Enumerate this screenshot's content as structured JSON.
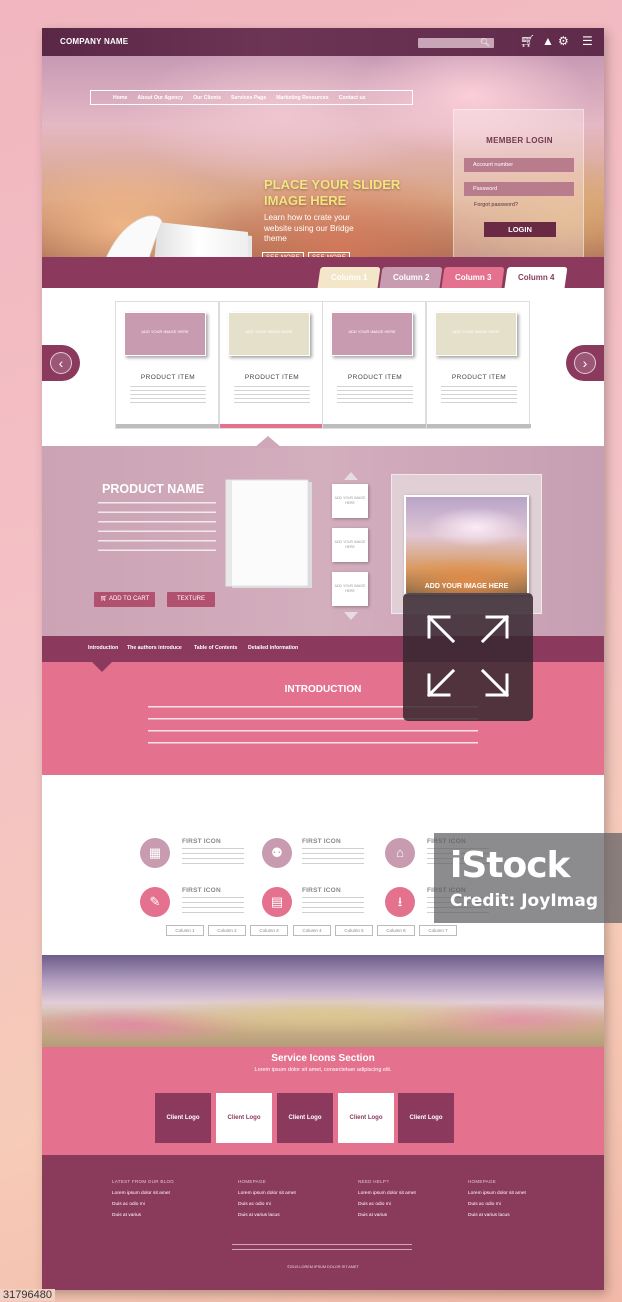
{
  "header": {
    "company_name": "COMPANY NAME",
    "icons": [
      "search-icon",
      "cart-icon",
      "user-icon",
      "gear-icon",
      "menu-icon"
    ]
  },
  "nav": {
    "items": [
      "Home",
      "About Our Agency",
      "Our Clients",
      "Services Page",
      "Marketing Resources",
      "Contact us"
    ]
  },
  "hero": {
    "slider_title": "PLACE YOUR SLIDER IMAGE HERE",
    "slider_subtitle": "Learn how to crate your website using our Bridge theme",
    "see_more_1": "SEE MORE",
    "see_more_2": "SEE MORE"
  },
  "login": {
    "title": "MEMBER LOGIN",
    "account_placeholder": "Account number",
    "password_placeholder": "Password",
    "forgot": "Forgot password?",
    "button": "LOGIN"
  },
  "column_tabs": [
    "Column 1",
    "Column 2",
    "Column 3",
    "Column 4"
  ],
  "products": [
    {
      "image_text": "ADD YOUR IMAGE HERE",
      "title": "PRODUCT ITEM"
    },
    {
      "image_text": "ADD YOUR IMAGE HERE",
      "title": "PRODUCT ITEM"
    },
    {
      "image_text": "ADD YOUR IMAGE HERE",
      "title": "PRODUCT ITEM"
    },
    {
      "image_text": "ADD YOUR IMAGE HERE",
      "title": "PRODUCT ITEM"
    }
  ],
  "product_detail": {
    "name": "PRODUCT NAME",
    "add_to_cart": "ADD TO CART",
    "texture": "TEXTURE",
    "thumb_text": "ADD YOUR IMAGE HERE",
    "popup_caption": "ADD YOUR IMAGE HERE"
  },
  "intro_tabs": [
    "Introduction",
    "The authors introduce",
    "Table of Contents",
    "Detailed information"
  ],
  "introduction": {
    "title": "INTRODUCTION"
  },
  "icon_section": {
    "items": [
      {
        "title": "FIRST ICON",
        "icon": "calendar-icon"
      },
      {
        "title": "FIRST ICON",
        "icon": "location-pin-icon"
      },
      {
        "title": "FIRST ICON",
        "icon": "home-icon"
      },
      {
        "title": "FIRST ICON",
        "icon": "edit-icon"
      },
      {
        "title": "FIRST ICON",
        "icon": "browser-window-icon"
      },
      {
        "title": "FIRST ICON",
        "icon": "download-icon"
      }
    ],
    "column_buttons": [
      "Column 1",
      "Column 2",
      "Column 3",
      "Column 4",
      "Column 5",
      "Column 6",
      "Column 7"
    ]
  },
  "service": {
    "title": "Service Icons Section",
    "subtitle": "Lorem ipsum dolor sit amet, consectetuer adipiscing elit.",
    "client_logos": [
      "Client Logo",
      "Client Logo",
      "Client Logo",
      "Client Logo",
      "Client Logo"
    ]
  },
  "footer": {
    "columns": [
      {
        "heading": "LATEST FROM OUR BLOG",
        "links": [
          "Lorem ipsum dolor sit amet",
          "Duis ac odio mi",
          "Duis at varius"
        ]
      },
      {
        "heading": "HOMEPAGE",
        "links": [
          "Lorem ipsum dolor sit amet",
          "Duis ac odio mi",
          "Duis at varius lacus"
        ]
      },
      {
        "heading": "NEED HELP?",
        "links": [
          "Lorem ipsum dolor sit amet",
          "Duis ac odio mi",
          "Duis at varius"
        ]
      },
      {
        "heading": "HOMEPAGE",
        "links": [
          "Lorem ipsum dolor sit amet",
          "Duis ac odio mi",
          "Duis at varius lacus"
        ]
      }
    ],
    "copyright": "©2015 LOREM IPSUM DOLOR SIT AMET"
  },
  "watermark": {
    "brand": "iStock",
    "credit": "Credit: JoyImag",
    "stock_id": "31796480"
  },
  "colors": {
    "dark_plum": "#8b3a5e",
    "pink": "#e4728f",
    "mauve": "#cba3b4",
    "slider_title": "#f3e47e"
  }
}
